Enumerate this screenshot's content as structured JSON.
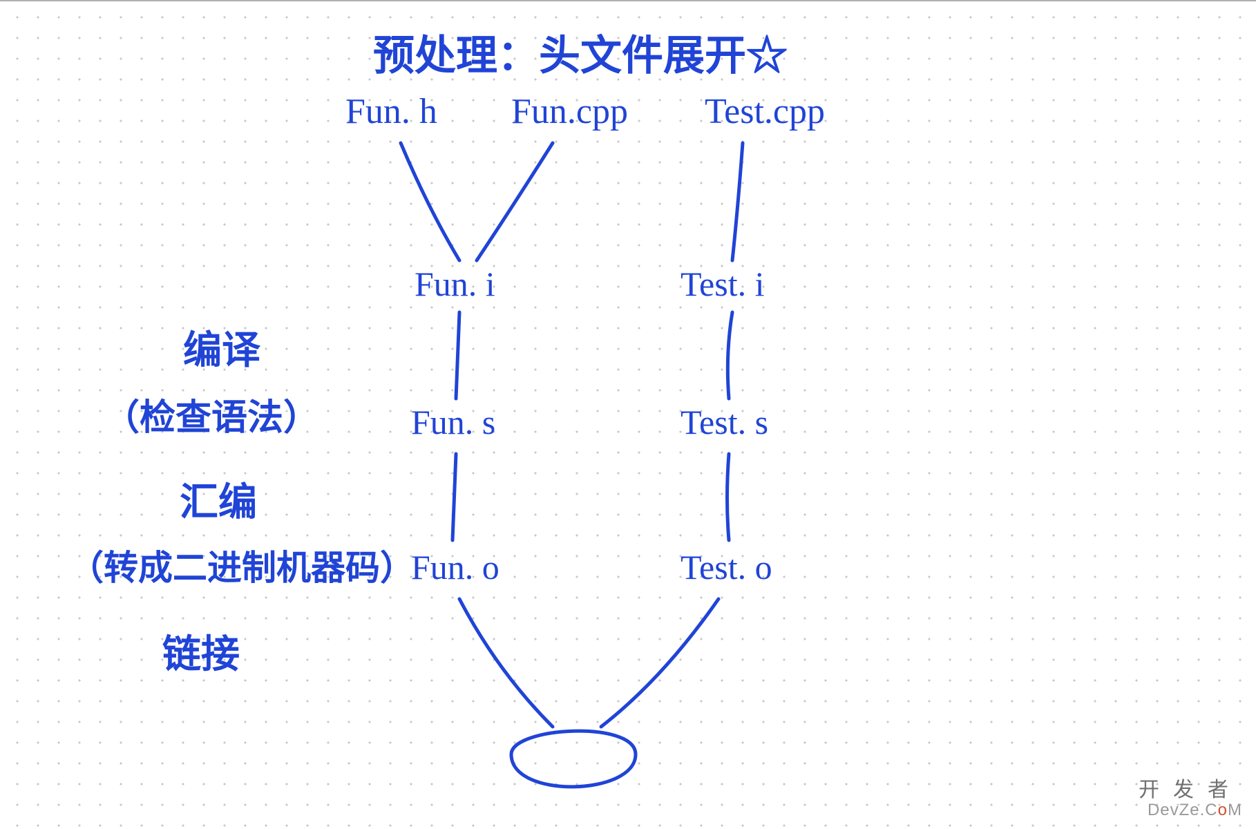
{
  "title": "预处理：头文件展开☆",
  "files_top": {
    "fun_h": "Fun. h",
    "fun_cpp": "Fun.cpp",
    "test_cpp": "Test.cpp"
  },
  "stage_i": {
    "fun": "Fun. i",
    "test": "Test. i"
  },
  "stage_s": {
    "fun": "Fun. s",
    "test": "Test. s"
  },
  "stage_o": {
    "fun": "Fun. o",
    "test": "Test. o"
  },
  "side": {
    "compile": "编译",
    "compile_note": "（检查语法）",
    "assemble": "汇编",
    "assemble_note": "（转成二进制机器码）",
    "link": "链接"
  },
  "watermark": {
    "row1": "开发者",
    "row2_before": "DevZe.C",
    "row2_o": "o",
    "row2_after": "M"
  },
  "colors": {
    "ink": "#2044d6",
    "dot": "#c8c8c8"
  }
}
